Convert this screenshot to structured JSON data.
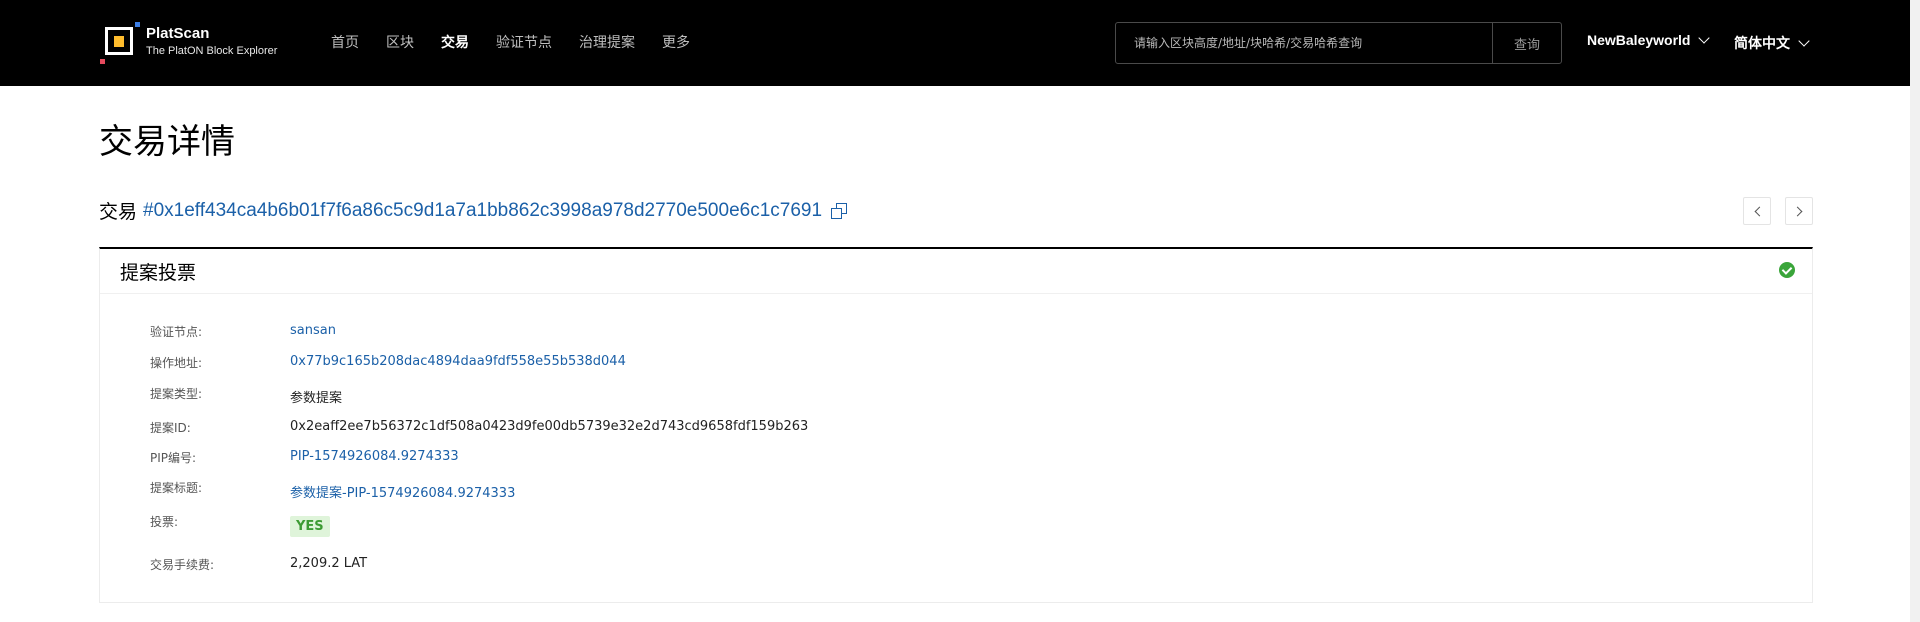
{
  "header": {
    "logo_title": "PlatScan",
    "logo_subtitle": "The PlatON Block Explorer",
    "nav": [
      "首页",
      "区块",
      "交易",
      "验证节点",
      "治理提案",
      "更多"
    ],
    "nav_active": "交易",
    "search_placeholder": "请输入区块高度/地址/块哈希/交易哈希查询",
    "search_button": "查询",
    "network": "NewBaleyworld",
    "language": "简体中文"
  },
  "page": {
    "title": "交易详情",
    "tx_label": "交易",
    "tx_hash": "#0x1eff434ca4b6b01f7f6a86c5c9d1a7a1bb862c3998a978d2770e500e6c1c7691"
  },
  "card": {
    "title": "提案投票",
    "status": "success",
    "fields": {
      "validator_label": "验证节点:",
      "validator_value": "sansan",
      "operator_label": "操作地址:",
      "operator_value": "0x77b9c165b208dac4894daa9fdf558e55b538d044",
      "proposal_type_label": "提案类型:",
      "proposal_type_value": "参数提案",
      "proposal_id_label": "提案ID:",
      "proposal_id_value": "0x2eaff2ee7b56372c1df508a0423d9fe00db5739e32e2d743cd9658fdf159b263",
      "pip_label": "PIP编号:",
      "pip_value": "PIP-1574926084.9274333",
      "proposal_title_label": "提案标题:",
      "proposal_title_value": "参数提案-PIP-1574926084.9274333",
      "vote_label": "投票:",
      "vote_value": "YES",
      "fee_label": "交易手续费:",
      "fee_value": "2,209.2 LAT"
    }
  },
  "colors": {
    "link": "#1b60a8",
    "success": "#3aa53a",
    "vote_badge_bg": "#dff4da",
    "header_bg": "#000000",
    "logo_accent": "#ffbc2d"
  }
}
